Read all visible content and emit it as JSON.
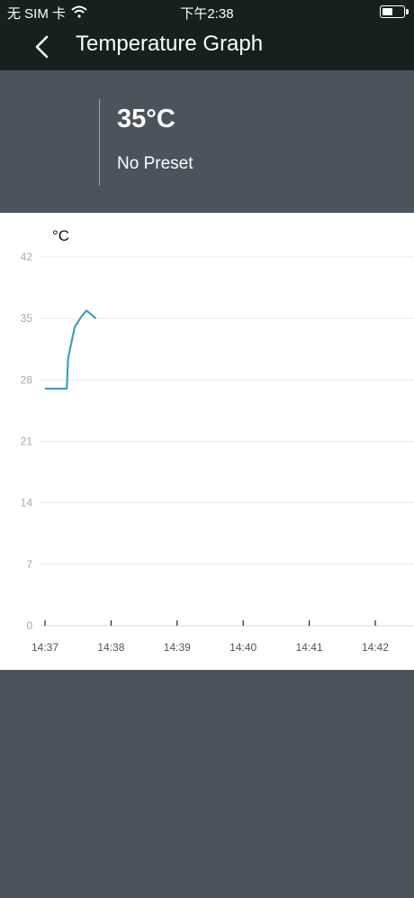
{
  "status_bar": {
    "carrier": "无 SIM 卡",
    "time": "下午2:38"
  },
  "nav": {
    "title": "Temperature Graph"
  },
  "header": {
    "temperature": "35°C",
    "preset": "No Preset"
  },
  "colors": {
    "line": "#3fa0bb",
    "nav_bg": "#16201f",
    "panel_bg": "#4b545a"
  },
  "chart_data": {
    "type": "line",
    "ylabel": "°C",
    "yticks": [
      0,
      7,
      14,
      21,
      28,
      35,
      42
    ],
    "ylim": [
      0,
      42
    ],
    "xticks": [
      "14:37",
      "14:38",
      "14:39",
      "14:40",
      "14:41",
      "14:42"
    ],
    "series": [
      {
        "x": [
          0,
          0.33,
          0.35,
          0.45,
          0.55,
          0.63,
          0.77
        ],
        "y": [
          27,
          27,
          30.5,
          34,
          35.2,
          35.9,
          35
        ]
      }
    ],
    "grid": true
  }
}
